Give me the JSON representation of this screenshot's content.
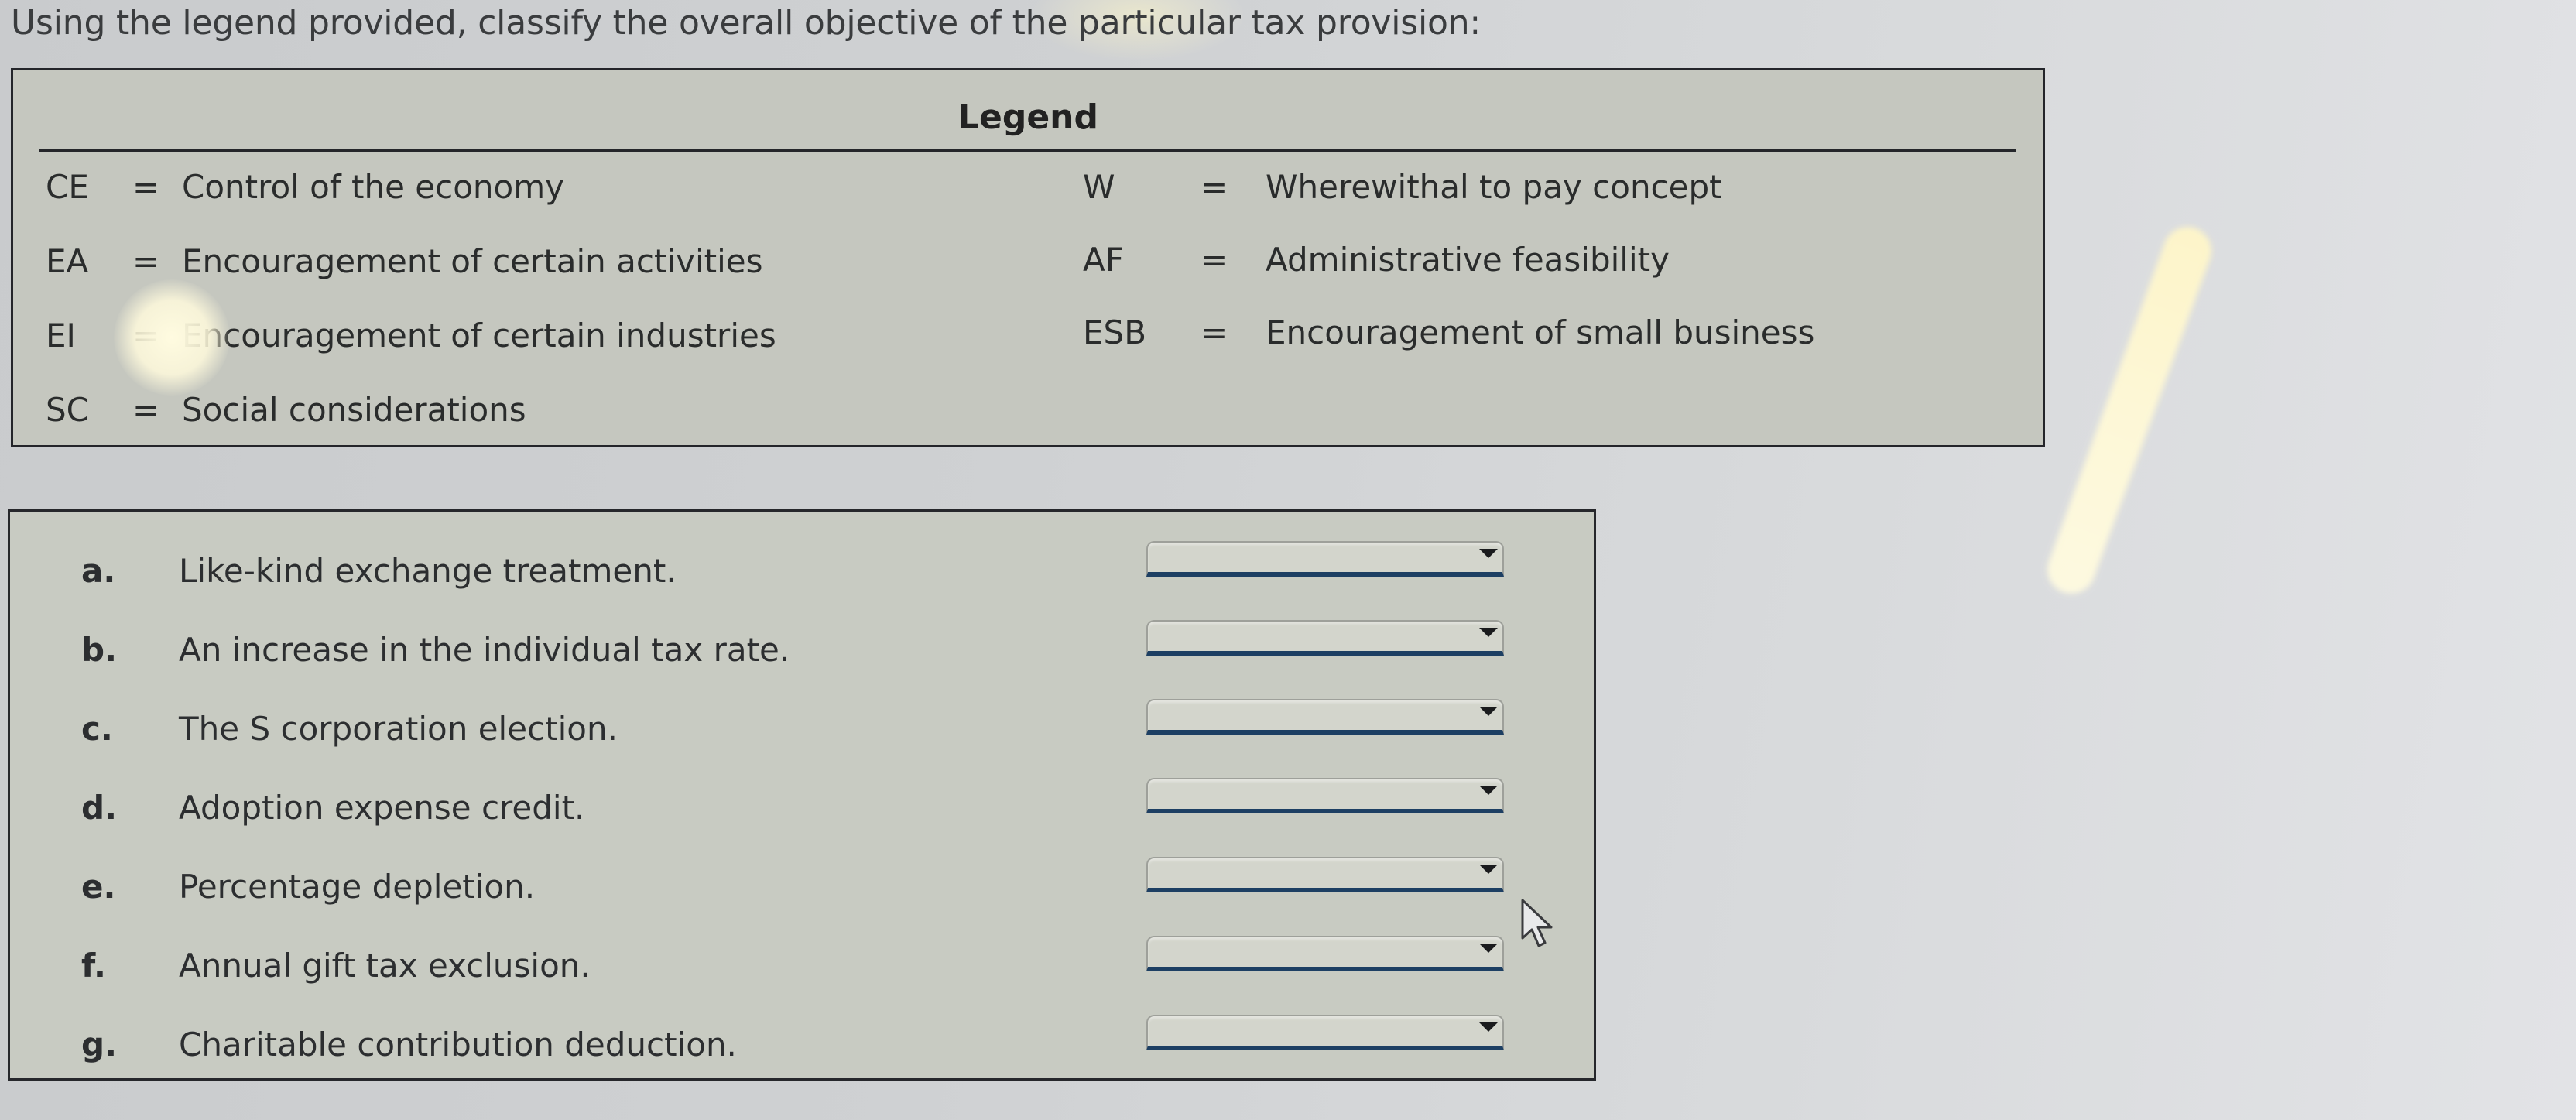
{
  "instruction": "Using the legend provided, classify the overall objective of the particular tax provision:",
  "legend": {
    "title": "Legend",
    "equals": "=",
    "left": [
      {
        "code": "CE",
        "description": "Control of the economy"
      },
      {
        "code": "EA",
        "description": "Encouragement of certain activities"
      },
      {
        "code": "EI",
        "description": "Encouragement of certain industries"
      },
      {
        "code": "SC",
        "description": "Social considerations"
      }
    ],
    "right": [
      {
        "code": "W",
        "description": "Wherewithal to pay concept"
      },
      {
        "code": "AF",
        "description": "Administrative feasibility"
      },
      {
        "code": "ESB",
        "description": "Encouragement of small business"
      }
    ]
  },
  "questions": [
    {
      "label": "a.",
      "text": "Like-kind exchange treatment.",
      "selected": ""
    },
    {
      "label": "b.",
      "text": "An increase in the individual tax rate.",
      "selected": ""
    },
    {
      "label": "c.",
      "text": "The S corporation election.",
      "selected": ""
    },
    {
      "label": "d.",
      "text": "Adoption expense credit.",
      "selected": ""
    },
    {
      "label": "e.",
      "text": "Percentage depletion.",
      "selected": ""
    },
    {
      "label": "f.",
      "text": "Annual gift tax exclusion.",
      "selected": ""
    },
    {
      "label": "g.",
      "text": "Charitable contribution deduction.",
      "selected": ""
    }
  ],
  "colors": {
    "panel_bg": "#c8cbc2",
    "border": "#26272b",
    "dropdown_underline": "#1d3f63"
  }
}
